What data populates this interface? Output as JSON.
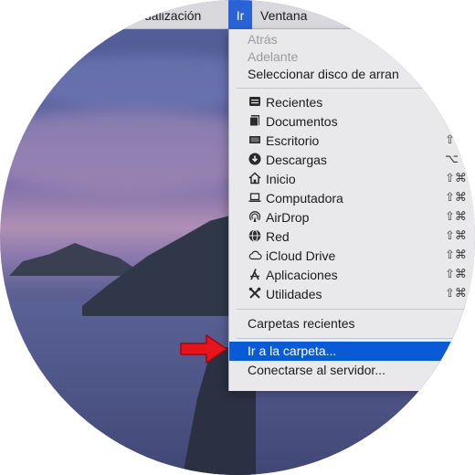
{
  "menubar": {
    "view_label": "ualización",
    "go_label": "Ir",
    "window_label": "Ventana"
  },
  "go_menu": {
    "nav_items": [
      {
        "label": "Atrás",
        "enabled": false
      },
      {
        "label": "Adelante",
        "enabled": false
      },
      {
        "label": "Seleccionar disco de arran",
        "enabled": true
      }
    ],
    "locations": [
      {
        "label": "Recientes",
        "icon": "recents-icon",
        "shortcut": ""
      },
      {
        "label": "Documentos",
        "icon": "documents-icon",
        "shortcut": ""
      },
      {
        "label": "Escritorio",
        "icon": "desktop-icon",
        "shortcut": "⇧"
      },
      {
        "label": "Descargas",
        "icon": "downloads-icon",
        "shortcut": "⌥"
      },
      {
        "label": "Inicio",
        "icon": "home-icon",
        "shortcut": "⇧⌘"
      },
      {
        "label": "Computadora",
        "icon": "computer-icon",
        "shortcut": "⇧⌘"
      },
      {
        "label": "AirDrop",
        "icon": "airdrop-icon",
        "shortcut": "⇧⌘"
      },
      {
        "label": "Red",
        "icon": "network-icon",
        "shortcut": "⇧⌘"
      },
      {
        "label": "iCloud Drive",
        "icon": "icloud-icon",
        "shortcut": "⇧⌘"
      },
      {
        "label": "Aplicaciones",
        "icon": "applications-icon",
        "shortcut": "⇧⌘"
      },
      {
        "label": "Utilidades",
        "icon": "utilities-icon",
        "shortcut": "⇧⌘"
      }
    ],
    "recent_folders": "Carpetas recientes",
    "go_to_folder": "Ir a la carpeta...",
    "connect_to_server": "Conectarse al servidor..."
  },
  "colors": {
    "selection": "#0a5ad8",
    "menubar_selected": "#2a63d6",
    "arrow": "#e8141c"
  }
}
